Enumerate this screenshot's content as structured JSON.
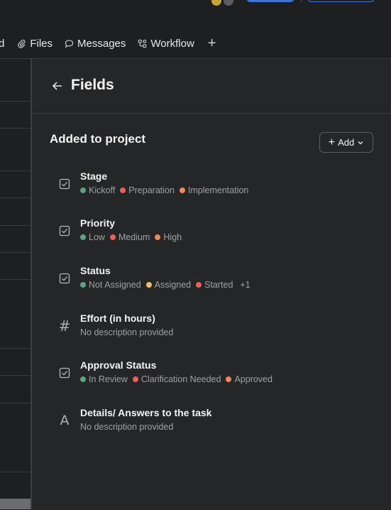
{
  "tabs": {
    "partial_label": "d",
    "files": "Files",
    "messages": "Messages",
    "workflow": "Workflow",
    "add": "+"
  },
  "panel": {
    "title": "Fields",
    "section_title": "Added to project",
    "add_button": "Add"
  },
  "colors": {
    "green": "#5da283",
    "red": "#e8615a",
    "orange": "#f1875c",
    "yellow": "#f1bd6c",
    "accent": "#4573d2"
  },
  "fields": [
    {
      "name": "Stage",
      "icon": "checkbox-icon",
      "options": [
        {
          "label": "Kickoff",
          "color": "green"
        },
        {
          "label": "Preparation",
          "color": "red"
        },
        {
          "label": "Implementation",
          "color": "orange"
        }
      ]
    },
    {
      "name": "Priority",
      "icon": "checkbox-icon",
      "options": [
        {
          "label": "Low",
          "color": "green"
        },
        {
          "label": "Medium",
          "color": "red"
        },
        {
          "label": "High",
          "color": "orange"
        }
      ]
    },
    {
      "name": "Status",
      "icon": "checkbox-icon",
      "options": [
        {
          "label": "Not Assigned",
          "color": "green"
        },
        {
          "label": "Assigned",
          "color": "yellow"
        },
        {
          "label": "Started",
          "color": "red"
        }
      ],
      "more": "+1"
    },
    {
      "name": "Effort (in hours)",
      "icon": "hash-icon",
      "description": "No description provided"
    },
    {
      "name": "Approval Status",
      "icon": "checkbox-icon",
      "options": [
        {
          "label": "In Review",
          "color": "green"
        },
        {
          "label": "Clarification Needed",
          "color": "red"
        },
        {
          "label": "Approved",
          "color": "orange"
        }
      ]
    },
    {
      "name": "Details/ Answers to the task",
      "icon": "text-icon",
      "description": "No description provided"
    }
  ]
}
